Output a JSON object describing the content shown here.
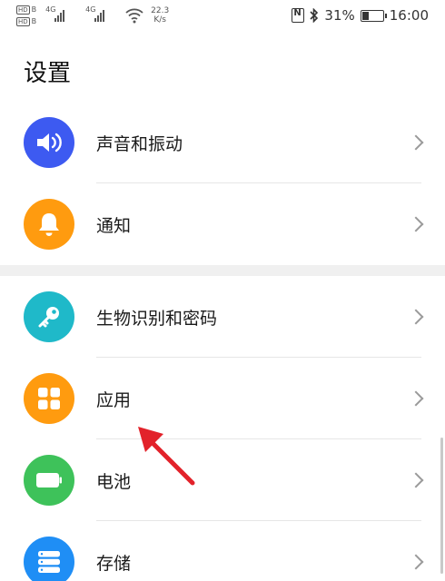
{
  "status_bar": {
    "hd1": "HD",
    "hd1_sub": "B",
    "hd2": "HD",
    "hd2_sub": "B",
    "net1": "4G",
    "net2": "4G",
    "speed_value": "22.3",
    "speed_unit": "K/s",
    "battery_percent": "31%",
    "battery_level": 0.31,
    "time": "16:00"
  },
  "page": {
    "title": "设置"
  },
  "settings": {
    "items": [
      {
        "label": "声音和振动",
        "icon": "speaker-icon",
        "color": "#3d5af1"
      },
      {
        "label": "通知",
        "icon": "bell-icon",
        "color": "#ff9b0f"
      },
      {
        "label": "生物识别和密码",
        "icon": "key-icon",
        "color": "#1fb9c9"
      },
      {
        "label": "应用",
        "icon": "apps-grid-icon",
        "color": "#ff9b0f"
      },
      {
        "label": "电池",
        "icon": "battery-icon",
        "color": "#3ec25a"
      },
      {
        "label": "存储",
        "icon": "storage-icon",
        "color": "#1f8ef5"
      }
    ]
  },
  "annotation": {
    "color": "#e2222a"
  }
}
